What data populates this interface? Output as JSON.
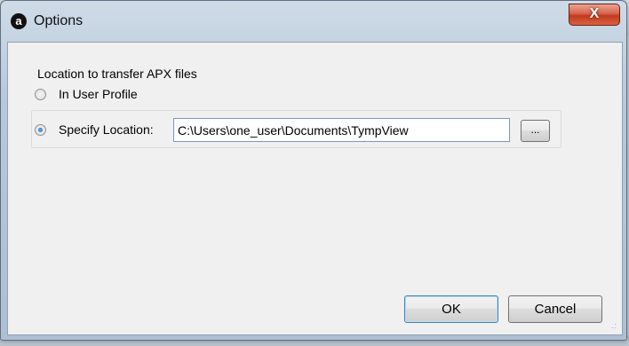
{
  "window": {
    "title": "Options",
    "close_label": "X"
  },
  "location": {
    "group_label": "Location to transfer APX files",
    "option_user_profile": "In User Profile",
    "option_specify": "Specify Location:",
    "selected_option": "Specify Location:",
    "path_value": "C:\\Users\\one_user\\Documents\\TympView",
    "browse_label": "..."
  },
  "buttons": {
    "ok_label": "OK",
    "cancel_label": "Cancel"
  }
}
